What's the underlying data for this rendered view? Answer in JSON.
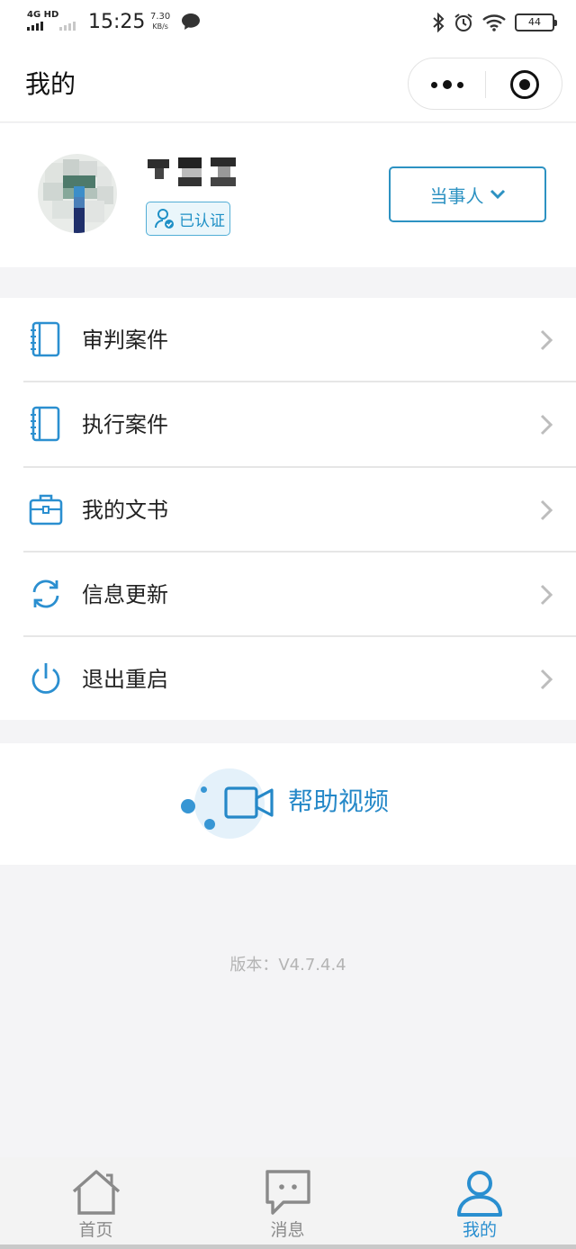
{
  "status_bar": {
    "network": "4G HD",
    "time": "15:25",
    "speed_value": "7.30",
    "speed_unit": "KB/s",
    "battery": "44"
  },
  "nav": {
    "title": "我的"
  },
  "profile": {
    "verified_label": "已认证",
    "role_button_label": "当事人"
  },
  "menu": {
    "items": [
      {
        "label": "审判案件",
        "icon": "notebook-icon"
      },
      {
        "label": "执行案件",
        "icon": "notebook-icon"
      },
      {
        "label": "我的文书",
        "icon": "briefcase-icon"
      },
      {
        "label": "信息更新",
        "icon": "refresh-icon"
      },
      {
        "label": "退出重启",
        "icon": "power-icon"
      }
    ]
  },
  "help": {
    "label": "帮助视频",
    "icon": "video-camera-icon"
  },
  "version": "版本：V4.7.4.4",
  "tabbar": {
    "tabs": [
      {
        "label": "首页",
        "icon": "home-icon",
        "active": false
      },
      {
        "label": "消息",
        "icon": "message-icon",
        "active": false
      },
      {
        "label": "我的",
        "icon": "user-icon",
        "active": true
      }
    ]
  },
  "colors": {
    "accent": "#2d92c2",
    "icon_blue": "#2b8fd0",
    "tab_active": "#2a8fd0",
    "background": "#f4f4f6"
  }
}
